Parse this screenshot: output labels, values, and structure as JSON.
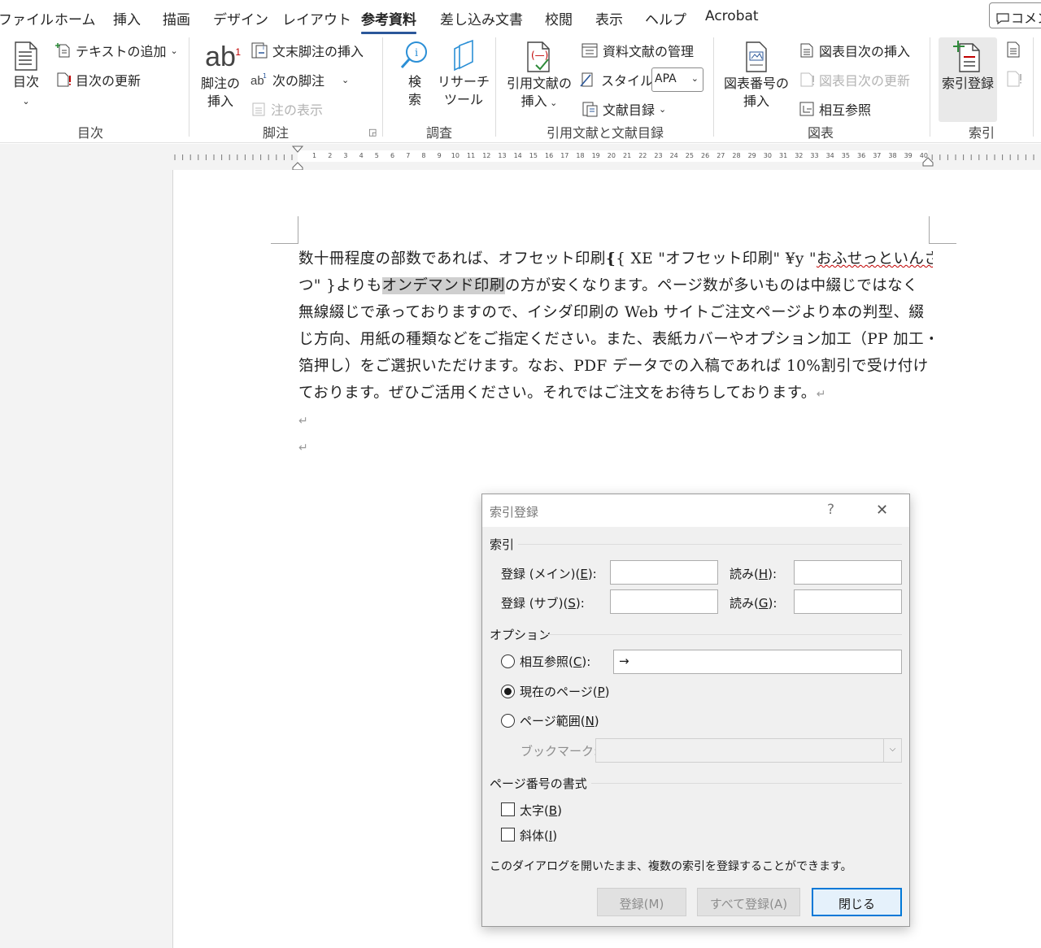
{
  "tabs": [
    {
      "label": "ファイル"
    },
    {
      "label": "ホーム"
    },
    {
      "label": "挿入"
    },
    {
      "label": "描画"
    },
    {
      "label": "デザイン"
    },
    {
      "label": "レイアウト"
    },
    {
      "label": "参考資料",
      "active": true
    },
    {
      "label": "差し込み文書"
    },
    {
      "label": "校閲"
    },
    {
      "label": "表示"
    },
    {
      "label": "ヘルプ"
    },
    {
      "label": "Acrobat"
    }
  ],
  "comment_button": "コメント",
  "ribbon": {
    "toc": {
      "big_label": "目次",
      "add_text": "テキストの追加",
      "update_toc": "目次の更新",
      "group": "目次"
    },
    "footnotes": {
      "big_label_1": "脚注の",
      "big_label_2": "挿入",
      "insert_endnote": "文末脚注の挿入",
      "next_footnote": "次の脚注",
      "show_notes": "注の表示",
      "group": "脚注"
    },
    "research": {
      "search_1": "検",
      "search_2": "索",
      "researcher_1": "リサーチ",
      "researcher_2": "ツール",
      "group": "調査"
    },
    "citations": {
      "insert_1": "引用文献の",
      "insert_2": "挿入",
      "manage": "資料文献の管理",
      "style_label": "スタイル:",
      "style_value": "APA",
      "bibliography": "文献目録",
      "group": "引用文献と文献目録"
    },
    "captions": {
      "insert_1": "図表番号の",
      "insert_2": "挿入",
      "insert_tof": "図表目次の挿入",
      "update_tof": "図表目次の更新",
      "cross_ref": "相互参照",
      "group": "図表"
    },
    "index": {
      "mark_entry": "索引登録",
      "group": "索引"
    }
  },
  "ruler_numbers": [
    "1",
    "2",
    "3",
    "4",
    "5",
    "6",
    "7",
    "8",
    "9",
    "10",
    "11",
    "12",
    "13",
    "14",
    "15",
    "16",
    "17",
    "18",
    "19",
    "20",
    "21",
    "22",
    "23",
    "24",
    "25",
    "26",
    "27",
    "28",
    "29",
    "30",
    "31",
    "32",
    "33",
    "34",
    "35",
    "36",
    "37",
    "38",
    "39",
    "40"
  ],
  "document": {
    "l1_a": "数十冊程度の部数であれば、オフセット印刷",
    "l1_field": "{ XE \"オフセット印刷\" ¥y \"",
    "l1_wavy": "おふせっといんさ",
    "l2_field_end": "つ\" }",
    "l2_a": "よりも",
    "l2_hl": "オンデマンド印刷",
    "l2_b": "の方が安くなります。ページ数が多いものは中綴じではなく",
    "l3": "無線綴じで承っておりますので、イシダ印刷の Web サイトご注文ページより本の判型、綴",
    "l4": "じ方向、用紙の種類などをご指定ください。また、表紙カバーやオプション加工（PP 加工・",
    "l5": "箔押し）をご選択いただけます。なお、PDF データでの入稿であれば 10%割引で受け付け",
    "l6": "ております。ぜひご活用ください。それではご注文をお待ちしております。",
    "para_mark": "↵"
  },
  "dialog": {
    "title": "索引登録",
    "help": "?",
    "close": "✕",
    "section_index": "索引",
    "main_entry_label": "登録 (メイン)(",
    "main_entry_key": "E",
    "main_entry_end": "):",
    "main_entry_value": "",
    "main_yomi_label": "読み(",
    "main_yomi_key": "H",
    "main_yomi_end": "):",
    "main_yomi_value": "",
    "sub_entry_label": "登録 (サブ)(",
    "sub_entry_key": "S",
    "sub_entry_end": "):",
    "sub_entry_value": "",
    "sub_yomi_label": "読み(",
    "sub_yomi_key": "G",
    "sub_yomi_end": "):",
    "sub_yomi_value": "",
    "section_options": "オプション",
    "opt_cross_ref": "相互参照(",
    "opt_cross_ref_key": "C",
    "opt_cross_ref_end": "):",
    "cross_ref_value": "→",
    "opt_current_page": "現在のページ(",
    "opt_current_page_key": "P",
    "opt_current_page_end": ")",
    "opt_page_range": "ページ範囲(",
    "opt_page_range_key": "N",
    "opt_page_range_end": ")",
    "bookmark_label": "ブックマーク:",
    "bookmark_value": "",
    "section_format": "ページ番号の書式",
    "bold": "太字(",
    "bold_key": "B",
    "bold_end": ")",
    "italic": "斜体(",
    "italic_key": "I",
    "italic_end": ")",
    "note": "このダイアログを開いたまま、複数の索引を登録することができます。",
    "btn_mark": "登録(M)",
    "btn_mark_all": "すべて登録(A)",
    "btn_close": "閉じる"
  },
  "colors": {
    "accent": "#2b579a",
    "primary_button_border": "#0078d7"
  }
}
